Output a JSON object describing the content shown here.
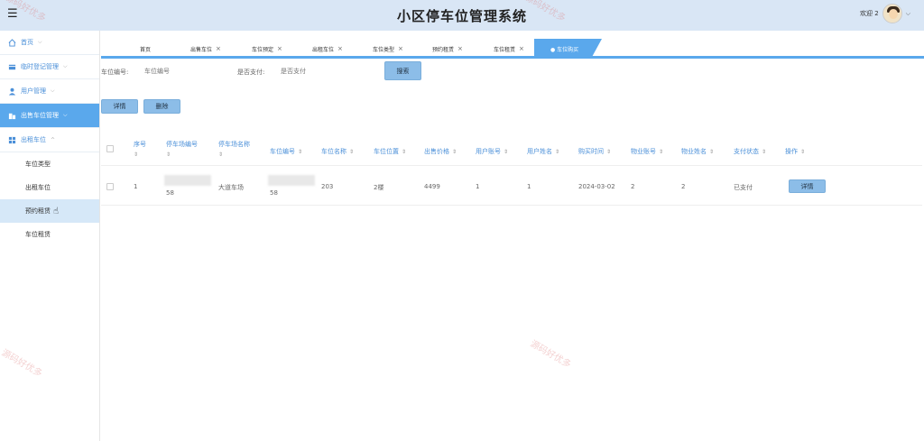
{
  "header": {
    "title": "小区停车位管理系统",
    "user_name": "欢迎 2",
    "menu_icon": "hamburger-icon",
    "dropdown_icon": "chevron-down-icon"
  },
  "sidebar": {
    "items": [
      {
        "label": "首页",
        "icon": "home-icon"
      },
      {
        "label": "临时登记管理",
        "icon": "card-icon"
      },
      {
        "label": "用户管理",
        "icon": "user-icon"
      },
      {
        "label": "出售车位管理",
        "icon": "building-icon",
        "active": true
      },
      {
        "label": "出租车位",
        "icon": "grid-icon",
        "open": true
      }
    ],
    "sub_items": [
      {
        "label": "车位类型"
      },
      {
        "label": "出租车位"
      },
      {
        "label": "预约租赁"
      },
      {
        "label": "车位租赁"
      }
    ]
  },
  "tabs": [
    {
      "label": "首页"
    },
    {
      "label": "出售车位"
    },
    {
      "label": "车位预定"
    },
    {
      "label": "出租车位"
    },
    {
      "label": "车位类型"
    },
    {
      "label": "预约租赁"
    },
    {
      "label": "车位租赁"
    },
    {
      "label": "● 车位购买",
      "active": true
    }
  ],
  "search": {
    "field1_label": "车位编号:",
    "field1_placeholder": "车位编号",
    "field2_label": "是否支付:",
    "field2_placeholder": "是否支付",
    "button_label": "搜索"
  },
  "actions": {
    "detail_label": "详情",
    "delete_label": "删除"
  },
  "table": {
    "columns": [
      "序号",
      "停车场编号",
      "停车场名称",
      "车位编号",
      "车位名称",
      "车位位置",
      "出售价格",
      "用户账号",
      "用户姓名",
      "购买时间",
      "物业账号",
      "物业姓名",
      "支付状态",
      "操作"
    ],
    "rows": [
      {
        "index": "1",
        "lot_code": "58",
        "lot_name": "大道车场",
        "space_code": "58",
        "space_name": "203",
        "space_location": "2楼",
        "price": "4499",
        "user_account": "1",
        "user_name": "1",
        "purchase_time": "2024-03-02",
        "property_account": "2",
        "property_name": "2",
        "pay_status": "已支付",
        "action_label": "详情"
      }
    ]
  },
  "watermark": "源码好优多",
  "colors": {
    "accent": "#5aa8ec",
    "header_bg": "#d9e6f5",
    "button": "#8cbde8"
  }
}
